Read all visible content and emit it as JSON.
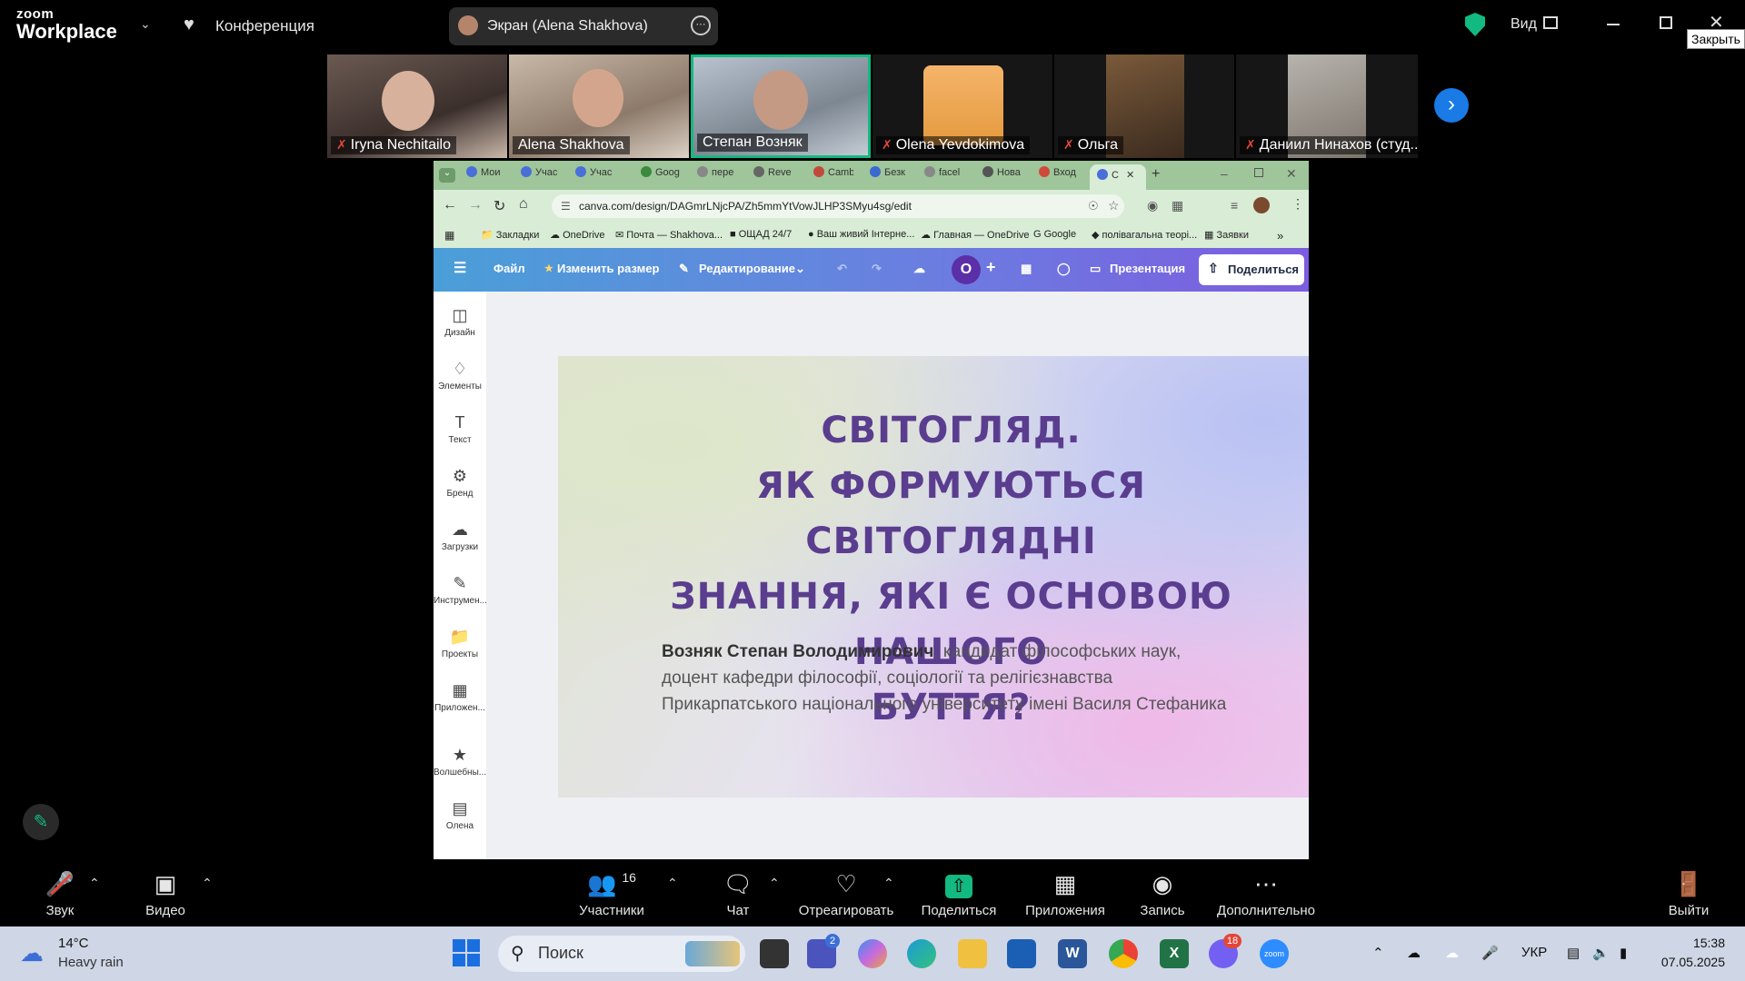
{
  "zoom": {
    "logo_top": "zoom",
    "logo_bottom": "Workplace",
    "meeting_label": "Конференция",
    "share_pill": "Экран (Alena Shakhova)",
    "view_label": "Вид",
    "close_tooltip": "Закрыть"
  },
  "participants": [
    {
      "name": "Iryna Nechitailo",
      "muted": true
    },
    {
      "name": "Alena Shakhova",
      "muted": false
    },
    {
      "name": "Степан Возняк",
      "muted": false,
      "active": true
    },
    {
      "name": "Olena Yevdokimova",
      "muted": true
    },
    {
      "name": "Ольга",
      "muted": true
    },
    {
      "name": "Даниил Нинахов (студ...",
      "muted": true
    }
  ],
  "browser": {
    "tabs": [
      "Мои",
      "Учас",
      "Учас",
      "Goog",
      "пере",
      "Reve",
      "Camb",
      "Безк",
      "facel",
      "Нова",
      "Вход",
      "С"
    ],
    "url": "canva.com/design/DAGmrLNjcPA/Zh5mmYtVowJLHP3SMyu4sg/edit",
    "bookmarks": [
      "Закладки",
      "OneDrive",
      "Почта — Shakhova...",
      "ОЩАД 24/7",
      "Ваш живий Інтерне...",
      "Главная — OneDrive",
      "Google",
      "полівагальна теорі...",
      "Заявки"
    ]
  },
  "canva": {
    "menu": {
      "file": "Файл",
      "resize": "Изменить размер",
      "editing": "Редактирование",
      "avatar": "O",
      "present": "Презентация",
      "share": "Поделиться"
    },
    "sidebar": [
      "Дизайн",
      "Элементы",
      "Текст",
      "Бренд",
      "Загрузки",
      "Инструмен...",
      "Проекты",
      "Приложен...",
      "Волшебны...",
      "Олена"
    ]
  },
  "slide": {
    "title_lines": [
      "СВІТОГЛЯД.",
      "ЯК ФОРМУЮТЬСЯ СВІТОГЛЯДНІ",
      "ЗНАННЯ, ЯКІ Є ОСНОВОЮ НАШОГО",
      "БУТТЯ?"
    ],
    "author_name": "Возняк Степан Володимирович",
    "author_rest": ", кандидат філософських наук,",
    "author_line2": "доцент кафедри філософії, соціології та релігієзнавства",
    "author_line3": "Прикарпатського національного університету імені Василя Стефаника"
  },
  "controls": {
    "audio": "Звук",
    "video": "Видео",
    "participants": "Участники",
    "participants_count": "16",
    "chat": "Чат",
    "react": "Отреагировать",
    "share": "Поделиться",
    "apps": "Приложения",
    "record": "Запись",
    "more": "Дополнительно",
    "leave": "Выйти"
  },
  "taskbar": {
    "temp": "14°C",
    "weather": "Heavy rain",
    "search": "Поиск",
    "teams_badge": "2",
    "viber_badge": "18",
    "lang": "УКР",
    "time": "15:38",
    "date": "07.05.2025"
  },
  "colors": {
    "zoom_share_green": "#12b981",
    "mute_red": "#e5463a",
    "tab_green": "#9fc59a",
    "canva_purple": "#7c5ce0",
    "slide_title": "#5b3d8f"
  }
}
